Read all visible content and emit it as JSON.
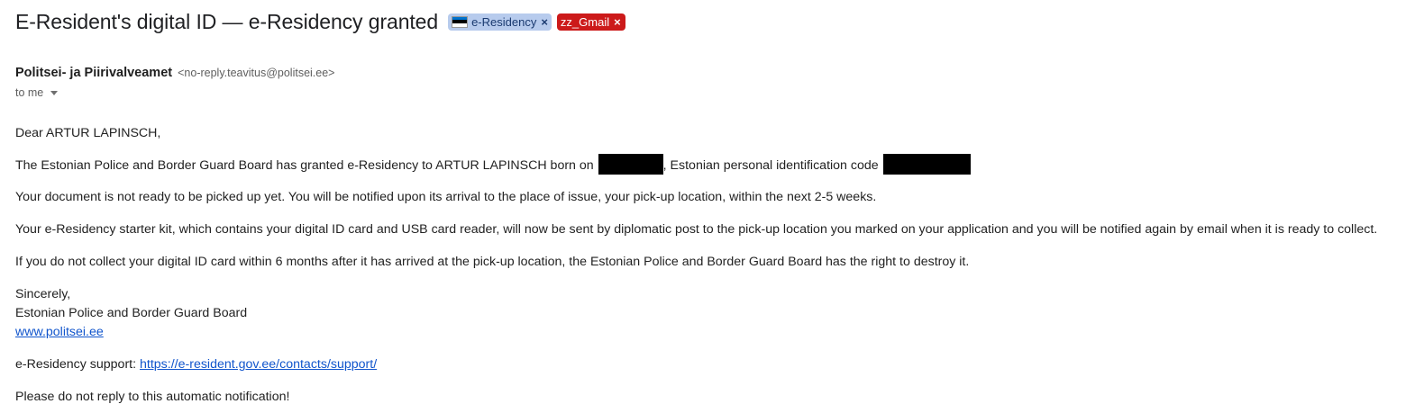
{
  "email": {
    "subject": "E-Resident's digital ID — e-Residency granted",
    "labels": [
      {
        "name": "e-Residency",
        "color": "#b7cbed",
        "icon": "estonia-flag-icon"
      },
      {
        "name": "zz_Gmail",
        "color": "#cc1a1a"
      }
    ],
    "sender": {
      "name": "Politsei- ja Piirivalveamet",
      "email": "<no-reply.teavitus@politsei.ee>"
    },
    "recipient": "to me"
  },
  "body": {
    "greeting": "Dear ARTUR LAPINSCH,",
    "granted_prefix": "The Estonian Police and Border Guard Board has granted e-Residency to ARTUR LAPINSCH born on",
    "granted_middle": ", Estonian personal identification code",
    "not_ready": "Your document is not ready to be picked up yet. You will be notified upon its arrival to the place of issue, your pick-up location, within the next 2-5 weeks.",
    "starter_kit": "Your e-Residency starter kit, which contains your digital ID card and USB card reader, will now be sent by diplomatic post to the pick-up location you marked on your application and you will be notified again by email when it is ready to collect.",
    "collect_warning": "If you do not collect your digital ID card within 6 months after it has arrived at the pick-up location, the Estonian Police and Border Guard Board has the right to destroy it.",
    "sign_off": "Sincerely,",
    "signature_org": "Estonian Police and Border Guard Board",
    "signature_link": "www.politsei.ee",
    "support_label": "e-Residency support: ",
    "support_link": "https://e-resident.gov.ee/contacts/support/",
    "footer_note": "Please do not reply to this automatic notification!"
  }
}
